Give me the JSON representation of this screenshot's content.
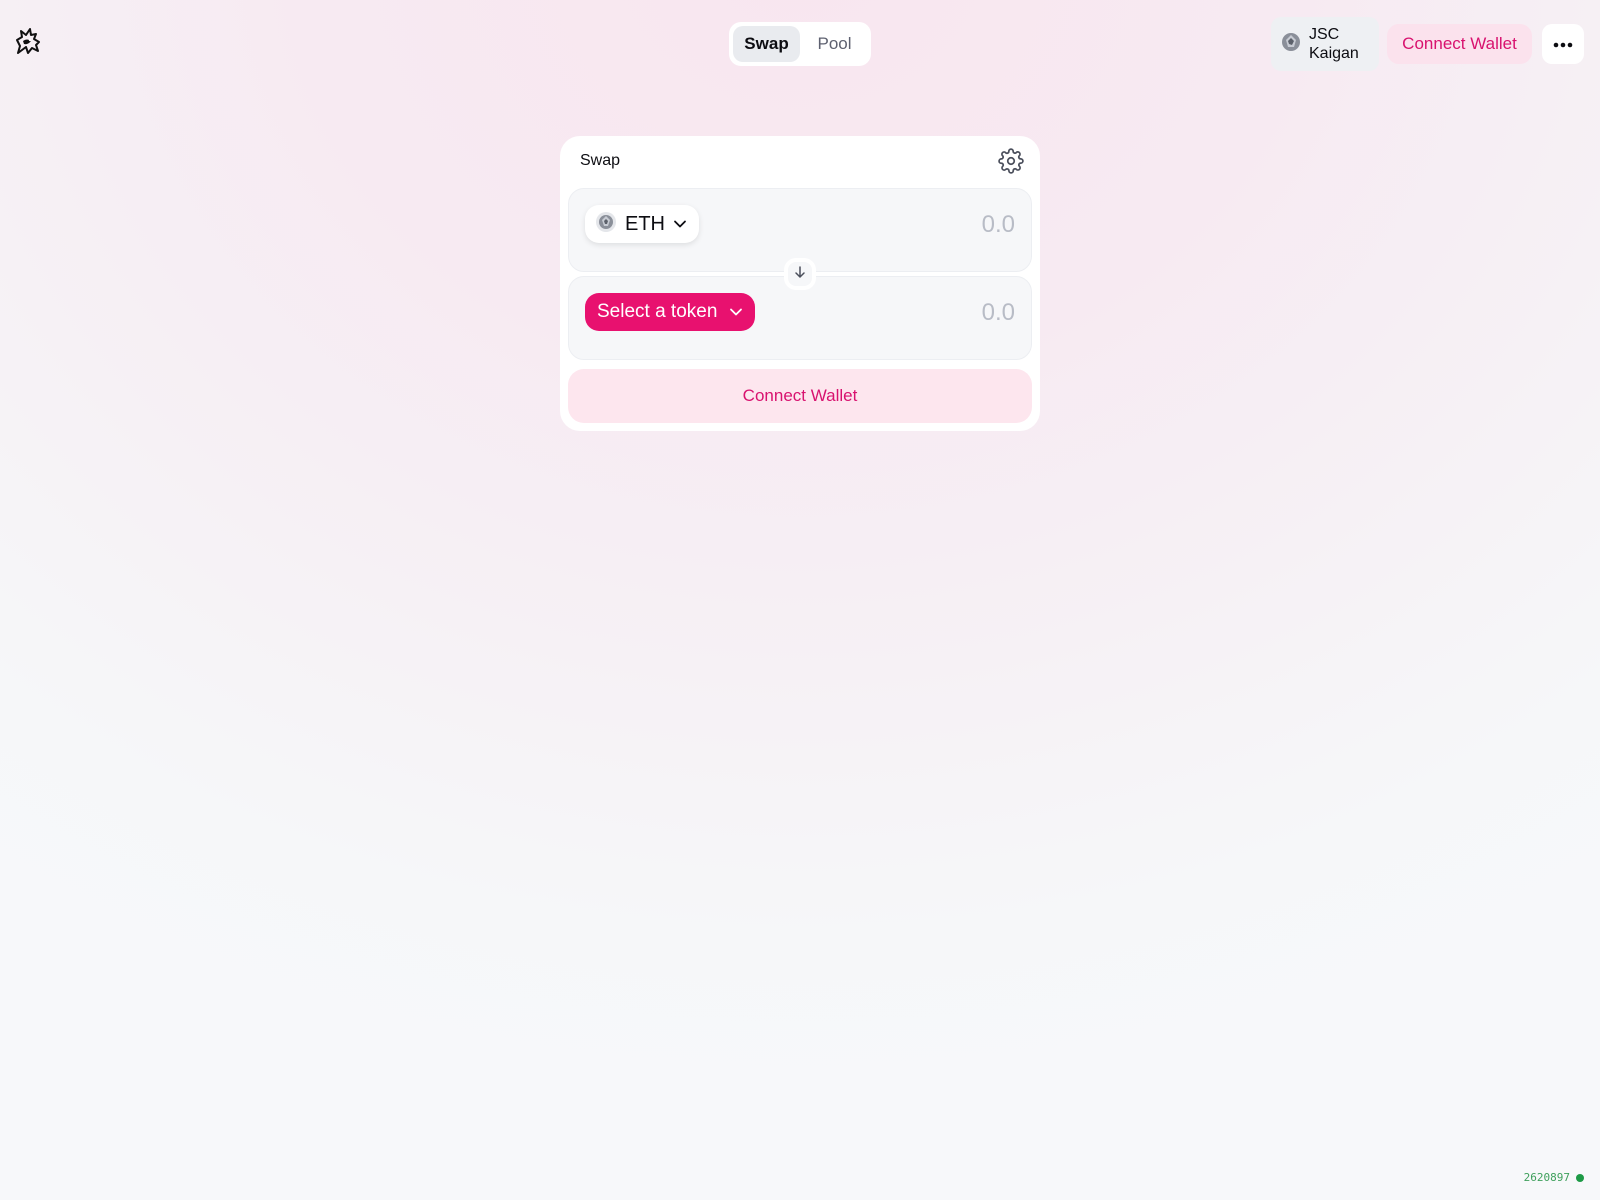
{
  "header": {
    "logo_icon": "unicorn-logo-icon",
    "nav_tabs": [
      {
        "label": "Swap",
        "active": true
      },
      {
        "label": "Pool",
        "active": false
      }
    ],
    "network": {
      "label": "JSC Kaigan",
      "icon": "network-token-icon"
    },
    "connect_wallet_label": "Connect Wallet",
    "more_icon": "ellipsis-icon"
  },
  "swap_card": {
    "title": "Swap",
    "settings_icon": "gear-icon",
    "input": {
      "token_symbol": "ETH",
      "token_icon": "eth-token-icon",
      "amount_placeholder": "0.0"
    },
    "switch_icon": "arrow-down-icon",
    "output": {
      "select_label": "Select a token",
      "amount_placeholder": "0.0"
    },
    "connect_wallet_label": "Connect Wallet"
  },
  "footer": {
    "block_number": "2620897",
    "status_color": "#1d9a46"
  },
  "colors": {
    "accent": "#e8116f",
    "accent_text": "#d8126f",
    "accent_soft": "#fde6ee"
  }
}
